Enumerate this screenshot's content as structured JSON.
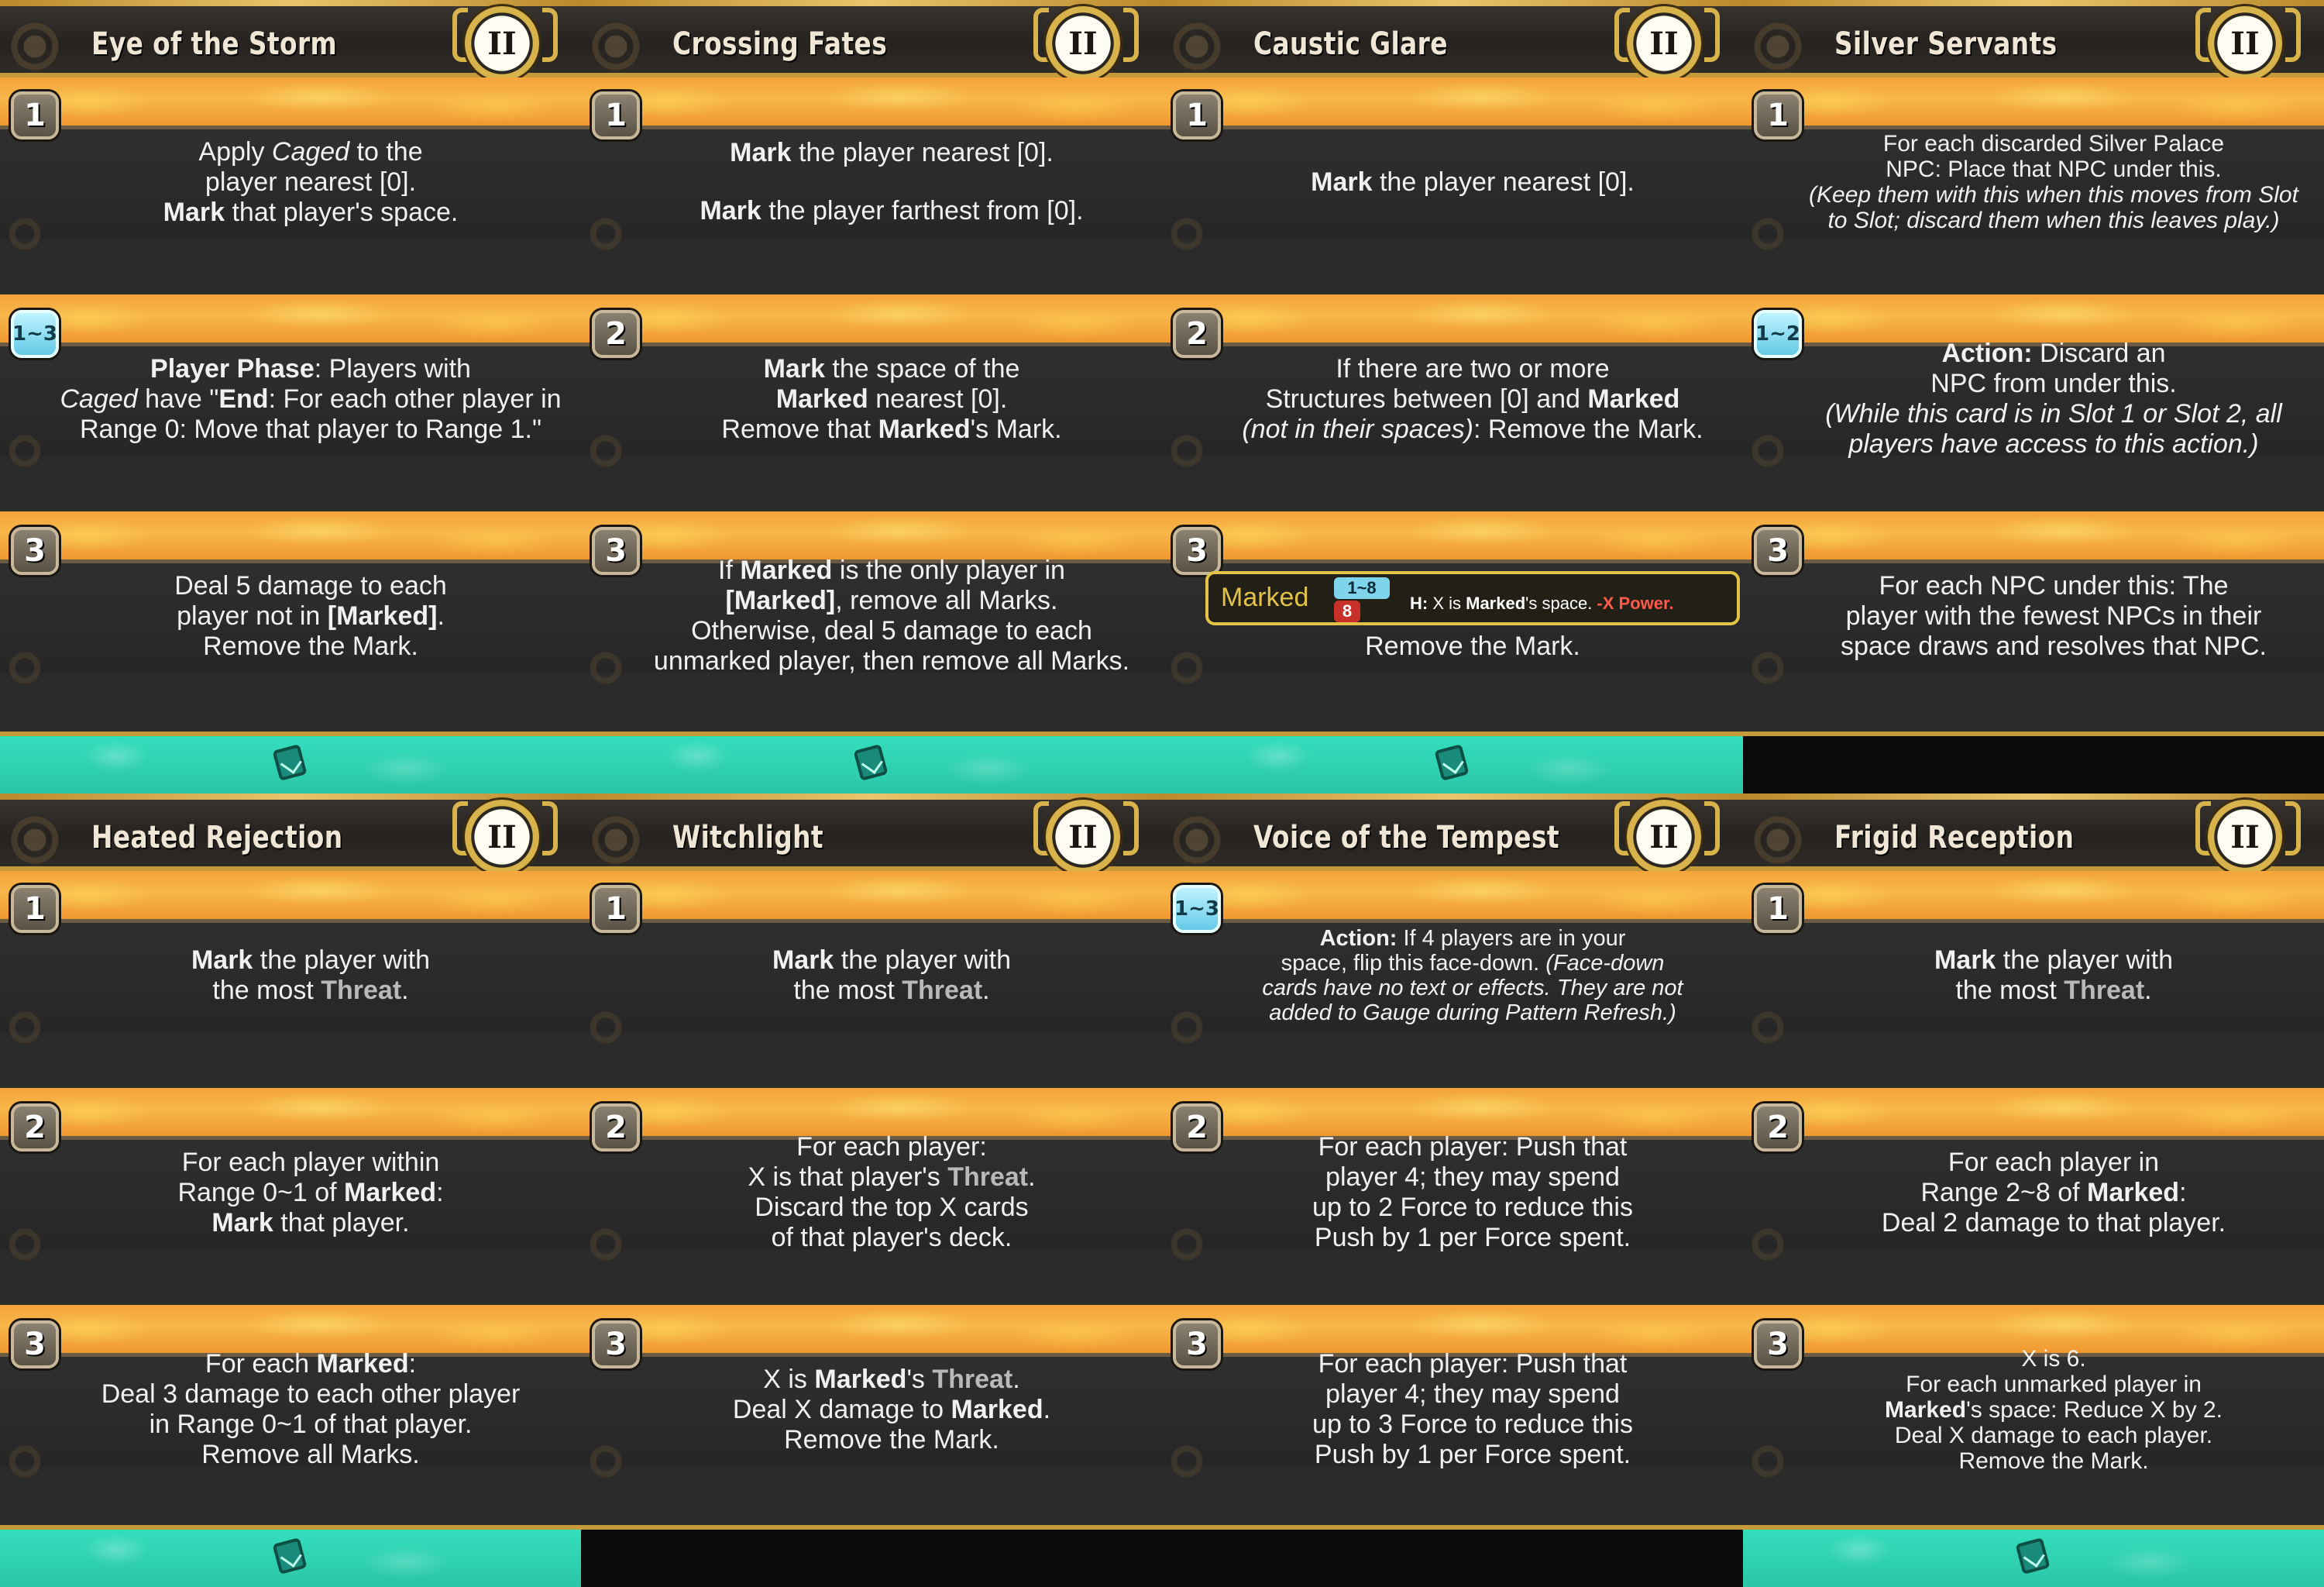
{
  "cards": [
    {
      "title": "Eye of the Storm",
      "tier": "II",
      "footer": "teal",
      "rows": [
        {
          "badge": "1",
          "badge_type": "step",
          "lines": [
            [
              {
                "t": "Apply "
              },
              {
                "t": "Caged",
                "s": "i"
              },
              {
                "t": " to the"
              }
            ],
            [
              {
                "t": "player nearest [0]."
              }
            ],
            [
              {
                "t": "Mark",
                "s": "b"
              },
              {
                "t": " that player's space."
              }
            ]
          ]
        },
        {
          "badge": "1~3",
          "badge_type": "range",
          "lines": [
            [
              {
                "t": "Player Phase",
                "s": "b"
              },
              {
                "t": ": Players with"
              }
            ],
            [
              {
                "t": "Caged",
                "s": "i"
              },
              {
                "t": " have \""
              },
              {
                "t": "End",
                "s": "b"
              },
              {
                "t": ": For each other player in"
              }
            ],
            [
              {
                "t": "Range 0: Move that player to Range 1.\""
              }
            ]
          ]
        },
        {
          "badge": "3",
          "badge_type": "step",
          "lines": [
            [
              {
                "t": "Deal 5 damage to each"
              }
            ],
            [
              {
                "t": "player not in "
              },
              {
                "t": "[Marked]",
                "s": "b"
              },
              {
                "t": "."
              }
            ],
            [
              {
                "t": "Remove the Mark."
              }
            ]
          ]
        }
      ]
    },
    {
      "title": "Crossing Fates",
      "tier": "II",
      "footer": "teal",
      "rows": [
        {
          "badge": "1",
          "badge_type": "step",
          "lines": [
            [
              {
                "t": "Mark",
                "s": "b"
              },
              {
                "t": " the player nearest [0]."
              }
            ],
            "gap",
            [
              {
                "t": "Mark",
                "s": "b"
              },
              {
                "t": " the player farthest from [0]."
              }
            ]
          ]
        },
        {
          "badge": "2",
          "badge_type": "step",
          "lines": [
            [
              {
                "t": "Mark",
                "s": "b"
              },
              {
                "t": " the space of the"
              }
            ],
            [
              {
                "t": "Marked",
                "s": "b"
              },
              {
                "t": " nearest [0]."
              }
            ],
            [
              {
                "t": "Remove that "
              },
              {
                "t": "Marked",
                "s": "b"
              },
              {
                "t": "'s Mark."
              }
            ]
          ]
        },
        {
          "badge": "3",
          "badge_type": "step",
          "lines": [
            [
              {
                "t": "If "
              },
              {
                "t": "Marked",
                "s": "b"
              },
              {
                "t": " is the only player in"
              }
            ],
            [
              {
                "t": "[Marked]",
                "s": "b"
              },
              {
                "t": ", remove all Marks."
              }
            ],
            [
              {
                "t": "Otherwise, deal 5 damage to each"
              }
            ],
            [
              {
                "t": "unmarked player, then remove all Marks."
              }
            ]
          ]
        }
      ]
    },
    {
      "title": "Caustic Glare",
      "tier": "II",
      "footer": "teal",
      "rows": [
        {
          "badge": "1",
          "badge_type": "step",
          "lines": [
            [
              {
                "t": "Mark",
                "s": "b"
              },
              {
                "t": " the player nearest [0]."
              }
            ]
          ]
        },
        {
          "badge": "2",
          "badge_type": "step",
          "lines": [
            [
              {
                "t": "If there are two or more"
              }
            ],
            [
              {
                "t": "Structures between [0] and "
              },
              {
                "t": "Marked",
                "s": "b"
              }
            ],
            [
              {
                "t": "(not in their spaces)",
                "s": "i"
              },
              {
                "t": ": Remove the Mark."
              }
            ]
          ]
        },
        {
          "badge": "3",
          "badge_type": "step",
          "token": {
            "name": "Marked",
            "range": "1~8",
            "hp": "8",
            "ability_prefix": "H:",
            "ability_mid1": " X is ",
            "ability_bold": "Marked",
            "ability_mid2": "'s space. ",
            "ability_neg": "-X Power."
          },
          "lines": [
            [
              {
                "t": "Remove the Mark."
              }
            ]
          ]
        }
      ]
    },
    {
      "title": "Silver Servants",
      "tier": "II",
      "footer": "dark",
      "rows": [
        {
          "badge": "1",
          "badge_type": "step",
          "size": "small",
          "lines": [
            [
              {
                "t": "For each discarded Silver Palace"
              }
            ],
            [
              {
                "t": "NPC: Place that NPC under this."
              }
            ],
            [
              {
                "t": "(Keep them with this when this moves from Slot",
                "s": "i"
              }
            ],
            [
              {
                "t": "to Slot; discard them when this leaves play.)",
                "s": "i"
              }
            ]
          ]
        },
        {
          "badge": "1~2",
          "badge_type": "range",
          "lines": [
            [
              {
                "t": "Action:",
                "s": "b"
              },
              {
                "t": " Discard an"
              }
            ],
            [
              {
                "t": "NPC from under this."
              }
            ],
            [
              {
                "t": "(While this card is in Slot 1 or Slot 2, all",
                "s": "i"
              }
            ],
            [
              {
                "t": "players have access to this action.)",
                "s": "i"
              }
            ]
          ]
        },
        {
          "badge": "3",
          "badge_type": "step",
          "lines": [
            [
              {
                "t": "For each NPC under this: The"
              }
            ],
            [
              {
                "t": "player with the fewest NPCs in their"
              }
            ],
            [
              {
                "t": "space draws and resolves that NPC."
              }
            ]
          ]
        }
      ]
    },
    {
      "title": "Heated Rejection",
      "tier": "II",
      "footer": "teal",
      "rows": [
        {
          "badge": "1",
          "badge_type": "step",
          "lines": [
            [
              {
                "t": "Mark",
                "s": "b"
              },
              {
                "t": " the player with"
              }
            ],
            [
              {
                "t": "the most "
              },
              {
                "t": "Threat",
                "s": "threat"
              },
              {
                "t": "."
              }
            ]
          ]
        },
        {
          "badge": "2",
          "badge_type": "step",
          "lines": [
            [
              {
                "t": "For each player within"
              }
            ],
            [
              {
                "t": "Range 0~1 of "
              },
              {
                "t": "Marked",
                "s": "b"
              },
              {
                "t": ":"
              }
            ],
            [
              {
                "t": "Mark",
                "s": "b"
              },
              {
                "t": " that player."
              }
            ]
          ]
        },
        {
          "badge": "3",
          "badge_type": "step",
          "lines": [
            [
              {
                "t": "For each "
              },
              {
                "t": "Marked",
                "s": "b"
              },
              {
                "t": ":"
              }
            ],
            [
              {
                "t": "Deal 3 damage to each other player"
              }
            ],
            [
              {
                "t": "in Range 0~1 of that player."
              }
            ],
            [
              {
                "t": "Remove all Marks."
              }
            ]
          ]
        }
      ]
    },
    {
      "title": "Witchlight",
      "tier": "II",
      "footer": "dark",
      "rows": [
        {
          "badge": "1",
          "badge_type": "step",
          "lines": [
            [
              {
                "t": "Mark",
                "s": "b"
              },
              {
                "t": " the player with"
              }
            ],
            [
              {
                "t": "the most "
              },
              {
                "t": "Threat",
                "s": "threat"
              },
              {
                "t": "."
              }
            ]
          ]
        },
        {
          "badge": "2",
          "badge_type": "step",
          "lines": [
            [
              {
                "t": "For each player:"
              }
            ],
            [
              {
                "t": "X is that player's "
              },
              {
                "t": "Threat",
                "s": "threat"
              },
              {
                "t": "."
              }
            ],
            [
              {
                "t": "Discard the top X cards"
              }
            ],
            [
              {
                "t": "of that player's deck."
              }
            ]
          ]
        },
        {
          "badge": "3",
          "badge_type": "step",
          "lines": [
            [
              {
                "t": "X is "
              },
              {
                "t": "Marked",
                "s": "b"
              },
              {
                "t": "'s "
              },
              {
                "t": "Threat",
                "s": "threat"
              },
              {
                "t": "."
              }
            ],
            [
              {
                "t": "Deal X damage to "
              },
              {
                "t": "Marked",
                "s": "b"
              },
              {
                "t": "."
              }
            ],
            [
              {
                "t": "Remove the Mark."
              }
            ]
          ]
        }
      ]
    },
    {
      "title": "Voice of the Tempest",
      "tier": "II",
      "footer": "dark",
      "rows": [
        {
          "badge": "1~3",
          "badge_type": "range",
          "size": "smaller",
          "lines": [
            [
              {
                "t": "Action:",
                "s": "b"
              },
              {
                "t": " If 4 players are in your"
              }
            ],
            [
              {
                "t": "space, flip this face-down. "
              },
              {
                "t": "(Face-down",
                "s": "i"
              }
            ],
            [
              {
                "t": "cards have no text or effects. They are not",
                "s": "i"
              }
            ],
            [
              {
                "t": "added to Gauge during Pattern Refresh.)",
                "s": "i"
              }
            ]
          ]
        },
        {
          "badge": "2",
          "badge_type": "step",
          "lines": [
            [
              {
                "t": "For each player: Push that"
              }
            ],
            [
              {
                "t": "player 4; they may spend"
              }
            ],
            [
              {
                "t": "up to 2 Force to reduce this"
              }
            ],
            [
              {
                "t": "Push by 1 per Force spent."
              }
            ]
          ]
        },
        {
          "badge": "3",
          "badge_type": "step",
          "lines": [
            [
              {
                "t": "For each player: Push that"
              }
            ],
            [
              {
                "t": "player 4; they may spend"
              }
            ],
            [
              {
                "t": "up to 3 Force to reduce this"
              }
            ],
            [
              {
                "t": "Push by 1 per Force spent."
              }
            ]
          ]
        }
      ]
    },
    {
      "title": "Frigid Reception",
      "tier": "II",
      "footer": "teal",
      "rows": [
        {
          "badge": "1",
          "badge_type": "step",
          "lines": [
            [
              {
                "t": "Mark",
                "s": "b"
              },
              {
                "t": " the player with"
              }
            ],
            [
              {
                "t": "the most "
              },
              {
                "t": "Threat",
                "s": "threat"
              },
              {
                "t": "."
              }
            ]
          ]
        },
        {
          "badge": "2",
          "badge_type": "step",
          "lines": [
            [
              {
                "t": "For each player in"
              }
            ],
            [
              {
                "t": "Range 2~8 of "
              },
              {
                "t": "Marked",
                "s": "b"
              },
              {
                "t": ":"
              }
            ],
            [
              {
                "t": "Deal 2 damage to that player."
              }
            ]
          ]
        },
        {
          "badge": "3",
          "badge_type": "step",
          "size": "small",
          "lines": [
            [
              {
                "t": "X is 6."
              }
            ],
            [
              {
                "t": "For each unmarked player in"
              }
            ],
            [
              {
                "t": "Marked",
                "s": "b"
              },
              {
                "t": "'s space: Reduce X by 2."
              }
            ],
            [
              {
                "t": "Deal X damage to each player."
              }
            ],
            [
              {
                "t": "Remove the Mark."
              }
            ]
          ]
        }
      ]
    }
  ]
}
